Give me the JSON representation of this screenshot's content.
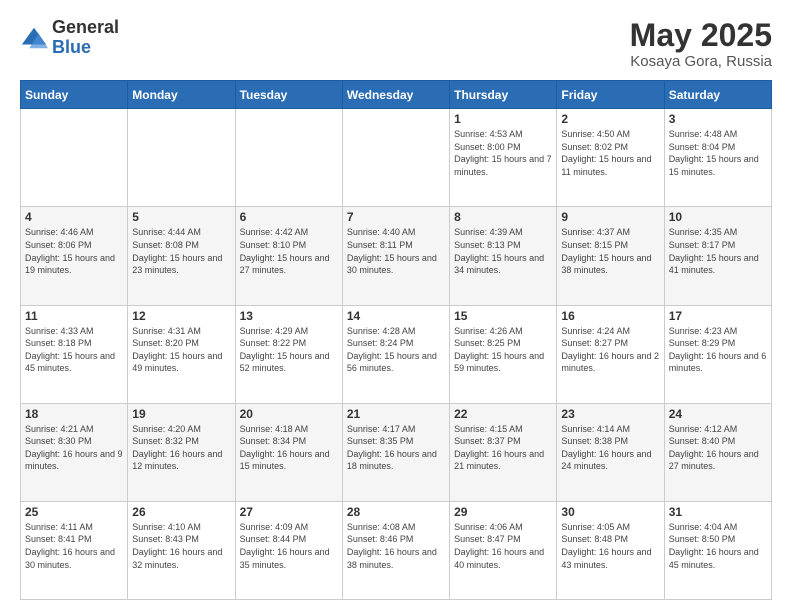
{
  "logo": {
    "general": "General",
    "blue": "Blue"
  },
  "header": {
    "title": "May 2025",
    "subtitle": "Kosaya Gora, Russia"
  },
  "weekdays": [
    "Sunday",
    "Monday",
    "Tuesday",
    "Wednesday",
    "Thursday",
    "Friday",
    "Saturday"
  ],
  "weeks": [
    [
      {
        "day": "",
        "info": ""
      },
      {
        "day": "",
        "info": ""
      },
      {
        "day": "",
        "info": ""
      },
      {
        "day": "",
        "info": ""
      },
      {
        "day": "1",
        "info": "Sunrise: 4:53 AM\nSunset: 8:00 PM\nDaylight: 15 hours and 7 minutes."
      },
      {
        "day": "2",
        "info": "Sunrise: 4:50 AM\nSunset: 8:02 PM\nDaylight: 15 hours and 11 minutes."
      },
      {
        "day": "3",
        "info": "Sunrise: 4:48 AM\nSunset: 8:04 PM\nDaylight: 15 hours and 15 minutes."
      }
    ],
    [
      {
        "day": "4",
        "info": "Sunrise: 4:46 AM\nSunset: 8:06 PM\nDaylight: 15 hours and 19 minutes."
      },
      {
        "day": "5",
        "info": "Sunrise: 4:44 AM\nSunset: 8:08 PM\nDaylight: 15 hours and 23 minutes."
      },
      {
        "day": "6",
        "info": "Sunrise: 4:42 AM\nSunset: 8:10 PM\nDaylight: 15 hours and 27 minutes."
      },
      {
        "day": "7",
        "info": "Sunrise: 4:40 AM\nSunset: 8:11 PM\nDaylight: 15 hours and 30 minutes."
      },
      {
        "day": "8",
        "info": "Sunrise: 4:39 AM\nSunset: 8:13 PM\nDaylight: 15 hours and 34 minutes."
      },
      {
        "day": "9",
        "info": "Sunrise: 4:37 AM\nSunset: 8:15 PM\nDaylight: 15 hours and 38 minutes."
      },
      {
        "day": "10",
        "info": "Sunrise: 4:35 AM\nSunset: 8:17 PM\nDaylight: 15 hours and 41 minutes."
      }
    ],
    [
      {
        "day": "11",
        "info": "Sunrise: 4:33 AM\nSunset: 8:18 PM\nDaylight: 15 hours and 45 minutes."
      },
      {
        "day": "12",
        "info": "Sunrise: 4:31 AM\nSunset: 8:20 PM\nDaylight: 15 hours and 49 minutes."
      },
      {
        "day": "13",
        "info": "Sunrise: 4:29 AM\nSunset: 8:22 PM\nDaylight: 15 hours and 52 minutes."
      },
      {
        "day": "14",
        "info": "Sunrise: 4:28 AM\nSunset: 8:24 PM\nDaylight: 15 hours and 56 minutes."
      },
      {
        "day": "15",
        "info": "Sunrise: 4:26 AM\nSunset: 8:25 PM\nDaylight: 15 hours and 59 minutes."
      },
      {
        "day": "16",
        "info": "Sunrise: 4:24 AM\nSunset: 8:27 PM\nDaylight: 16 hours and 2 minutes."
      },
      {
        "day": "17",
        "info": "Sunrise: 4:23 AM\nSunset: 8:29 PM\nDaylight: 16 hours and 6 minutes."
      }
    ],
    [
      {
        "day": "18",
        "info": "Sunrise: 4:21 AM\nSunset: 8:30 PM\nDaylight: 16 hours and 9 minutes."
      },
      {
        "day": "19",
        "info": "Sunrise: 4:20 AM\nSunset: 8:32 PM\nDaylight: 16 hours and 12 minutes."
      },
      {
        "day": "20",
        "info": "Sunrise: 4:18 AM\nSunset: 8:34 PM\nDaylight: 16 hours and 15 minutes."
      },
      {
        "day": "21",
        "info": "Sunrise: 4:17 AM\nSunset: 8:35 PM\nDaylight: 16 hours and 18 minutes."
      },
      {
        "day": "22",
        "info": "Sunrise: 4:15 AM\nSunset: 8:37 PM\nDaylight: 16 hours and 21 minutes."
      },
      {
        "day": "23",
        "info": "Sunrise: 4:14 AM\nSunset: 8:38 PM\nDaylight: 16 hours and 24 minutes."
      },
      {
        "day": "24",
        "info": "Sunrise: 4:12 AM\nSunset: 8:40 PM\nDaylight: 16 hours and 27 minutes."
      }
    ],
    [
      {
        "day": "25",
        "info": "Sunrise: 4:11 AM\nSunset: 8:41 PM\nDaylight: 16 hours and 30 minutes."
      },
      {
        "day": "26",
        "info": "Sunrise: 4:10 AM\nSunset: 8:43 PM\nDaylight: 16 hours and 32 minutes."
      },
      {
        "day": "27",
        "info": "Sunrise: 4:09 AM\nSunset: 8:44 PM\nDaylight: 16 hours and 35 minutes."
      },
      {
        "day": "28",
        "info": "Sunrise: 4:08 AM\nSunset: 8:46 PM\nDaylight: 16 hours and 38 minutes."
      },
      {
        "day": "29",
        "info": "Sunrise: 4:06 AM\nSunset: 8:47 PM\nDaylight: 16 hours and 40 minutes."
      },
      {
        "day": "30",
        "info": "Sunrise: 4:05 AM\nSunset: 8:48 PM\nDaylight: 16 hours and 43 minutes."
      },
      {
        "day": "31",
        "info": "Sunrise: 4:04 AM\nSunset: 8:50 PM\nDaylight: 16 hours and 45 minutes."
      }
    ]
  ]
}
